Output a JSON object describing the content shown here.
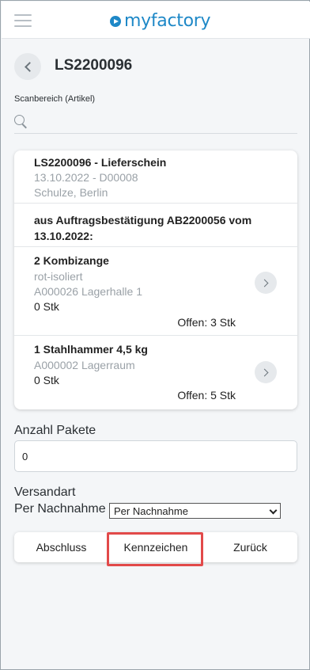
{
  "header": {
    "logo_text": "myfactory",
    "brand_color": "#1e88c7",
    "menu_icon": "hamburger-icon",
    "logo_icon": "play-circle-icon"
  },
  "page": {
    "title": "LS2200096",
    "back_icon": "chevron-left-icon"
  },
  "scan": {
    "label": "Scanbereich (Artikel)",
    "placeholder": "",
    "icon": "search-icon"
  },
  "document": {
    "title": "LS2200096 - Lieferschein",
    "date_line": "13.10.2022 - D00008",
    "customer": "Schulze, Berlin",
    "note": "aus Auftragsbestätigung AB2200056 vom 13.10.2022:",
    "items": [
      {
        "title": "2 Kombizange",
        "description": "rot-isoliert",
        "location": "A000026 Lagerhalle 1",
        "quantity": "0 Stk",
        "open": "Offen: 3 Stk"
      },
      {
        "title": "1 Stahlhammer 4,5 kg",
        "description": "",
        "location": "A000002 Lagerraum",
        "quantity": "0 Stk",
        "open": "Offen: 5 Stk"
      }
    ]
  },
  "form": {
    "packages_label": "Anzahl Pakete",
    "packages_value": "0",
    "shipping_label": "Versandart",
    "shipping_current": "Per Nachnahme",
    "shipping_selected": "Per Nachnahme"
  },
  "actions": {
    "finish": "Abschluss",
    "marks": "Kennzeichen",
    "back": "Zurück",
    "highlight_color": "#e24a4a"
  }
}
